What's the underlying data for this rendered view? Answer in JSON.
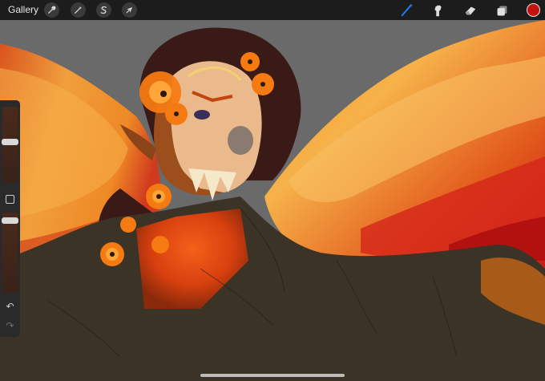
{
  "toolbar": {
    "gallery_label": "Gallery",
    "left_tools": [
      {
        "name": "actions",
        "icon": "wrench-icon"
      },
      {
        "name": "adjustments",
        "icon": "magic-wand-icon"
      },
      {
        "name": "selection",
        "icon": "selection-s-icon"
      },
      {
        "name": "transform",
        "icon": "arrow-cursor-icon"
      }
    ],
    "right_tools": [
      {
        "name": "brush",
        "icon": "brush-icon",
        "active": true
      },
      {
        "name": "smudge",
        "icon": "smudge-icon",
        "active": false
      },
      {
        "name": "eraser",
        "icon": "eraser-icon",
        "active": false
      },
      {
        "name": "layers",
        "icon": "layers-icon",
        "active": false
      }
    ],
    "current_color": "#c41010",
    "active_tool_color": "#1e7cf5"
  },
  "sidebar": {
    "brush_size_level": 0.25,
    "opacity_level": 0.2,
    "modify_icon": "square-modify-icon",
    "undo_icon": "undo-arrow-icon",
    "redo_icon": "redo-arrow-icon"
  },
  "canvas": {
    "background_color": "#6a6a6a",
    "subject": "painting"
  }
}
